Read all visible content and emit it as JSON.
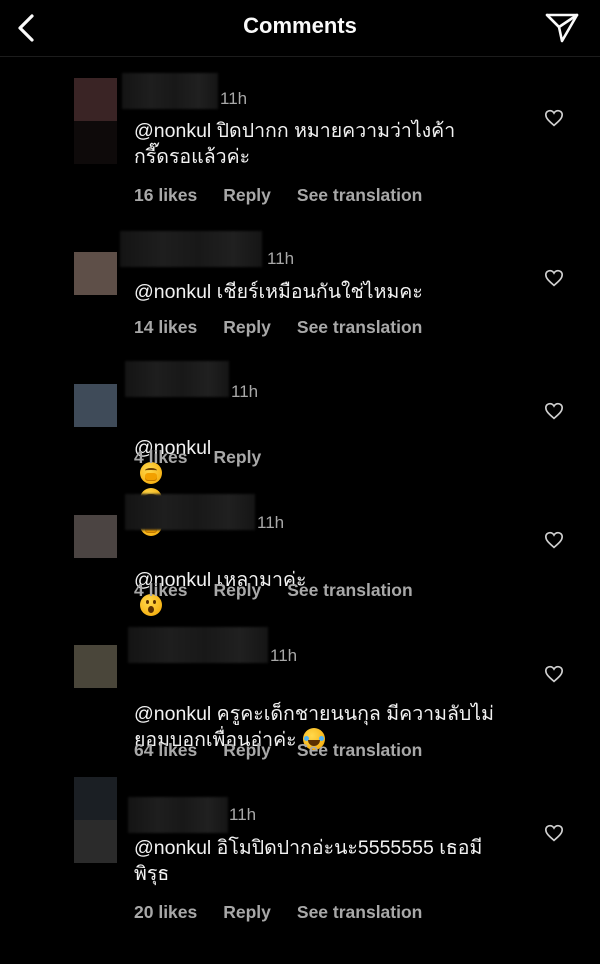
{
  "header": {
    "title": "Comments",
    "back_icon": "chevron-left-icon",
    "send_icon": "paper-plane-icon"
  },
  "reply_label": "Reply",
  "translate_label": "See translation",
  "colors": {
    "background": "#000000",
    "text": "#f5f5f5",
    "secondary": "#a8a8a8"
  },
  "comments": [
    {
      "time": "11h",
      "mention": "@nonkul",
      "text": "@nonkul ปิดปากก หมายความว่าไงค้า\nกรี๊ดรอแล้วค่ะ",
      "likes": "16 likes",
      "has_translation": true,
      "emoji": []
    },
    {
      "time": "11h",
      "mention": "@nonkul",
      "text": "@nonkul เชียร์เหมือนกันใช่ไหมคะ",
      "likes": "14 likes",
      "has_translation": true,
      "emoji": []
    },
    {
      "time": "11h",
      "mention": "@nonkul",
      "text": "@nonkul",
      "likes": "4 likes",
      "has_translation": false,
      "emoji": [
        "hush-emoji",
        "hush-emoji",
        "hush-emoji"
      ]
    },
    {
      "time": "11h",
      "mention": "@nonkul",
      "text": "@nonkul เหลามาค่ะ",
      "likes": "4 likes",
      "has_translation": true,
      "emoji": [
        "astonished-emoji"
      ]
    },
    {
      "time": "11h",
      "mention": "@nonkul",
      "text": "@nonkul ครูคะเด็กชายนนกุล มีความลับไม่\nยอมบอกเพื่อนอ่าค่ะ",
      "likes": "64 likes",
      "has_translation": true,
      "emoji": [
        "tears-of-joy-emoji"
      ]
    },
    {
      "time": "11h",
      "mention": "@nonkul",
      "text": "@nonkul อิโมปิดปากอ่ะนะ5555555 เธอมี\nพิรุธ",
      "likes": "20 likes",
      "has_translation": true,
      "emoji": []
    }
  ]
}
